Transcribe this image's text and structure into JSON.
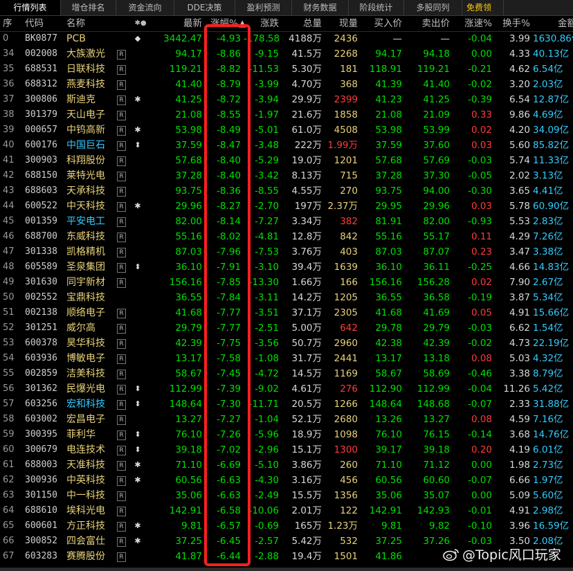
{
  "tabs": [
    "行情列表",
    "增仓排名",
    "资金流向",
    "DDE决策",
    "盈利预测",
    "财务数据",
    "阶段统计",
    "多股同列",
    "免费领"
  ],
  "headers": {
    "idx": "序",
    "code": "代码",
    "name": "名称",
    "mark": "✱●",
    "price": "最新",
    "chg": "涨幅%",
    "chgamt": "涨跌",
    "vol": "总量",
    "cur": "现量",
    "bid": "买入价",
    "ask": "卖出价",
    "spd": "涨速%",
    "turn": "换手%",
    "amt": "金额"
  },
  "sort_glyph": "▲",
  "watermark": "@Topic风口玩家",
  "rows": [
    {
      "idx": "0",
      "code": "BK0877",
      "name": "PCB",
      "r": "",
      "mark": "◆",
      "price": "3442.47",
      "chg": "-4.93",
      "chgamt": "-178.58",
      "vol": "4188万",
      "cur": "2436",
      "bid": "—",
      "ask": "—",
      "spd": "-0.04",
      "turn": "3.99",
      "amt": "1630.86亿"
    },
    {
      "idx": "34",
      "code": "002008",
      "name": "大族激光",
      "r": "R",
      "mark": "",
      "price": "94.17",
      "chg": "-8.86",
      "chgamt": "-9.15",
      "vol": "41.5万",
      "cur": "2268",
      "bid": "94.17",
      "ask": "94.18",
      "spd": "0.00",
      "turn": "4.33",
      "amt": "40.13亿"
    },
    {
      "idx": "35",
      "code": "688531",
      "name": "日联科技",
      "r": "R",
      "mark": "",
      "price": "119.21",
      "chg": "-8.82",
      "chgamt": "-11.53",
      "vol": "5.30万",
      "cur": "181",
      "bid": "118.91",
      "ask": "119.21",
      "spd": "-0.21",
      "turn": "4.62",
      "amt": "6.54亿"
    },
    {
      "idx": "36",
      "code": "688312",
      "name": "燕麦科技",
      "r": "R",
      "mark": "",
      "price": "41.40",
      "chg": "-8.79",
      "chgamt": "-3.99",
      "vol": "4.70万",
      "cur": "368",
      "bid": "41.39",
      "ask": "41.40",
      "spd": "-0.02",
      "turn": "3.20",
      "amt": "2.03亿"
    },
    {
      "idx": "37",
      "code": "300806",
      "name": "斯迪克",
      "r": "R",
      "mark": "✱",
      "price": "41.25",
      "chg": "-8.72",
      "chgamt": "-3.94",
      "vol": "29.9万",
      "cur": "2399",
      "curRed": true,
      "bid": "41.23",
      "ask": "41.25",
      "spd": "-0.39",
      "turn": "6.54",
      "amt": "12.87亿"
    },
    {
      "idx": "38",
      "code": "301379",
      "name": "天山电子",
      "r": "R",
      "mark": "",
      "price": "21.08",
      "chg": "-8.55",
      "chgamt": "-1.97",
      "vol": "21.6万",
      "cur": "1858",
      "bid": "21.08",
      "ask": "21.09",
      "spd": "0.33",
      "spdRed": true,
      "turn": "9.86",
      "amt": "4.69亿"
    },
    {
      "idx": "39",
      "code": "000657",
      "name": "中钨高新",
      "r": "R",
      "mark": "✱",
      "price": "53.98",
      "chg": "-8.49",
      "chgamt": "-5.01",
      "vol": "61.0万",
      "cur": "4508",
      "bid": "53.98",
      "ask": "53.99",
      "spd": "0.02",
      "spdRed": true,
      "turn": "4.20",
      "amt": "34.09亿"
    },
    {
      "idx": "40",
      "code": "600176",
      "name": "中国巨石",
      "cyan": true,
      "r": "R",
      "mark": "⬍",
      "price": "37.59",
      "chg": "-8.47",
      "chgamt": "-3.48",
      "vol": "222万",
      "cur": "1.99万",
      "curRed": true,
      "bid": "37.59",
      "ask": "37.60",
      "spd": "0.03",
      "spdRed": true,
      "turn": "5.60",
      "amt": "85.82亿"
    },
    {
      "idx": "41",
      "code": "300903",
      "name": "科翔股份",
      "r": "R",
      "mark": "",
      "price": "57.68",
      "chg": "-8.40",
      "chgamt": "-5.29",
      "vol": "19.0万",
      "cur": "1201",
      "bid": "57.68",
      "ask": "57.69",
      "spd": "-0.03",
      "turn": "5.74",
      "amt": "11.33亿"
    },
    {
      "idx": "42",
      "code": "688150",
      "name": "莱特光电",
      "r": "R",
      "mark": "",
      "price": "37.28",
      "chg": "-8.40",
      "chgamt": "-3.42",
      "vol": "8.13万",
      "cur": "715",
      "bid": "37.28",
      "ask": "37.30",
      "spd": "-0.05",
      "turn": "2.02",
      "amt": "3.13亿"
    },
    {
      "idx": "43",
      "code": "688603",
      "name": "天承科技",
      "r": "R",
      "mark": "",
      "price": "93.75",
      "chg": "-8.36",
      "chgamt": "-8.55",
      "vol": "4.55万",
      "cur": "270",
      "bid": "93.75",
      "ask": "94.00",
      "spd": "-0.30",
      "turn": "3.65",
      "amt": "4.41亿"
    },
    {
      "idx": "44",
      "code": "600522",
      "name": "中天科技",
      "r": "R",
      "mark": "✱",
      "price": "29.96",
      "chg": "-8.27",
      "chgamt": "-2.70",
      "vol": "197万",
      "cur": "2.37万",
      "bid": "29.95",
      "ask": "29.96",
      "spd": "0.03",
      "spdRed": true,
      "turn": "5.78",
      "amt": "60.90亿"
    },
    {
      "idx": "45",
      "code": "001359",
      "name": "平安电工",
      "cyan": true,
      "r": "R",
      "mark": "",
      "price": "82.00",
      "chg": "-8.14",
      "chgamt": "-7.27",
      "vol": "3.34万",
      "cur": "382",
      "curRed": true,
      "bid": "81.91",
      "ask": "82.00",
      "spd": "-0.93",
      "turn": "5.53",
      "amt": "2.83亿"
    },
    {
      "idx": "46",
      "code": "688700",
      "name": "东威科技",
      "r": "R",
      "mark": "",
      "price": "55.16",
      "chg": "-8.02",
      "chgamt": "-4.81",
      "vol": "12.8万",
      "cur": "842",
      "bid": "55.16",
      "ask": "55.17",
      "spd": "0.11",
      "spdRed": true,
      "turn": "4.29",
      "amt": "7.26亿"
    },
    {
      "idx": "47",
      "code": "301338",
      "name": "凯格精机",
      "r": "R",
      "mark": "",
      "price": "87.03",
      "chg": "-7.96",
      "chgamt": "-7.53",
      "vol": "3.76万",
      "cur": "403",
      "bid": "87.03",
      "ask": "87.07",
      "spd": "0.23",
      "spdRed": true,
      "turn": "3.47",
      "amt": "3.38亿"
    },
    {
      "idx": "48",
      "code": "605589",
      "name": "圣泉集团",
      "r": "R",
      "mark": "⬍",
      "price": "36.10",
      "chg": "-7.91",
      "chgamt": "-3.10",
      "vol": "39.4万",
      "cur": "1639",
      "bid": "36.10",
      "ask": "36.11",
      "spd": "-0.25",
      "turn": "4.66",
      "amt": "14.83亿"
    },
    {
      "idx": "49",
      "code": "301630",
      "name": "同宇新材",
      "r": "R",
      "mark": "",
      "price": "156.16",
      "chg": "-7.85",
      "chgamt": "-13.30",
      "vol": "1.66万",
      "cur": "166",
      "bid": "156.16",
      "ask": "156.28",
      "spd": "0.02",
      "spdRed": true,
      "turn": "7.90",
      "amt": "2.67亿"
    },
    {
      "idx": "50",
      "code": "002552",
      "name": "宝鼎科技",
      "r": "",
      "mark": "",
      "price": "36.55",
      "chg": "-7.84",
      "chgamt": "-3.11",
      "vol": "14.2万",
      "cur": "1205",
      "bid": "36.55",
      "ask": "36.58",
      "spd": "-0.19",
      "turn": "3.87",
      "amt": "5.34亿"
    },
    {
      "idx": "51",
      "code": "002138",
      "name": "顺络电子",
      "r": "R",
      "mark": "",
      "price": "41.68",
      "chg": "-7.77",
      "chgamt": "-3.51",
      "vol": "37.1万",
      "cur": "2305",
      "bid": "41.68",
      "ask": "41.69",
      "spd": "0.05",
      "spdRed": true,
      "turn": "4.91",
      "amt": "15.66亿"
    },
    {
      "idx": "52",
      "code": "301251",
      "name": "威尔高",
      "r": "R",
      "mark": "",
      "price": "29.79",
      "chg": "-7.77",
      "chgamt": "-2.51",
      "vol": "5.00万",
      "cur": "642",
      "curRed": true,
      "bid": "29.78",
      "ask": "29.79",
      "spd": "-0.03",
      "turn": "6.62",
      "amt": "1.54亿"
    },
    {
      "idx": "53",
      "code": "600378",
      "name": "昊华科技",
      "r": "R",
      "mark": "",
      "price": "42.39",
      "chg": "-7.75",
      "chgamt": "-3.56",
      "vol": "50.7万",
      "cur": "2960",
      "bid": "42.38",
      "ask": "42.39",
      "spd": "-0.02",
      "turn": "4.73",
      "amt": "22.19亿"
    },
    {
      "idx": "54",
      "code": "603936",
      "name": "博敏电子",
      "r": "R",
      "mark": "",
      "price": "13.17",
      "chg": "-7.58",
      "chgamt": "-1.08",
      "vol": "31.7万",
      "cur": "2441",
      "bid": "13.17",
      "ask": "13.18",
      "spd": "0.08",
      "spdRed": true,
      "turn": "5.03",
      "amt": "4.32亿"
    },
    {
      "idx": "55",
      "code": "002859",
      "name": "洁美科技",
      "r": "R",
      "mark": "",
      "price": "58.67",
      "chg": "-7.45",
      "chgamt": "-4.72",
      "vol": "14.5万",
      "cur": "1169",
      "bid": "58.67",
      "ask": "58.69",
      "spd": "-0.46",
      "turn": "3.38",
      "amt": "8.79亿"
    },
    {
      "idx": "56",
      "code": "301362",
      "name": "民爆光电",
      "r": "R",
      "mark": "⬍",
      "price": "112.99",
      "chg": "-7.39",
      "chgamt": "-9.02",
      "vol": "4.61万",
      "cur": "276",
      "curRed": true,
      "bid": "112.90",
      "ask": "112.99",
      "spd": "-0.04",
      "turn": "11.26",
      "amt": "5.42亿"
    },
    {
      "idx": "57",
      "code": "603256",
      "name": "宏和科技",
      "cyan": true,
      "r": "R",
      "mark": "⬍",
      "price": "148.64",
      "chg": "-7.30",
      "chgamt": "-11.71",
      "vol": "20.5万",
      "cur": "1266",
      "bid": "148.64",
      "ask": "148.68",
      "spd": "-0.07",
      "turn": "2.33",
      "amt": "31.88亿"
    },
    {
      "idx": "58",
      "code": "603002",
      "name": "宏昌电子",
      "r": "R",
      "mark": "",
      "price": "13.27",
      "chg": "-7.27",
      "chgamt": "-1.04",
      "vol": "52.1万",
      "cur": "2680",
      "bid": "13.26",
      "ask": "13.27",
      "spd": "0.08",
      "spdRed": true,
      "turn": "4.59",
      "amt": "7.16亿"
    },
    {
      "idx": "59",
      "code": "300395",
      "name": "菲利华",
      "r": "R",
      "mark": "⬍",
      "price": "76.10",
      "chg": "-7.26",
      "chgamt": "-5.96",
      "vol": "18.9万",
      "cur": "1098",
      "bid": "76.10",
      "ask": "76.15",
      "spd": "-0.14",
      "turn": "3.68",
      "amt": "14.76亿"
    },
    {
      "idx": "60",
      "code": "300679",
      "name": "电连技术",
      "r": "R",
      "mark": "⬍",
      "price": "39.18",
      "chg": "-7.02",
      "chgamt": "-2.96",
      "vol": "15.1万",
      "cur": "1300",
      "curRed": true,
      "bid": "39.17",
      "ask": "39.18",
      "spd": "0.20",
      "spdRed": true,
      "turn": "4.19",
      "amt": "6.01亿"
    },
    {
      "idx": "61",
      "code": "688003",
      "name": "天准科技",
      "r": "R",
      "mark": "✱",
      "price": "71.10",
      "chg": "-6.69",
      "chgamt": "-5.10",
      "vol": "3.86万",
      "cur": "260",
      "bid": "71.10",
      "ask": "71.12",
      "spd": "0.00",
      "turn": "1.98",
      "amt": "2.73亿"
    },
    {
      "idx": "62",
      "code": "300936",
      "name": "中英科技",
      "r": "R",
      "mark": "✱",
      "price": "60.56",
      "chg": "-6.63",
      "chgamt": "-4.30",
      "vol": "3.16万",
      "cur": "456",
      "bid": "60.56",
      "ask": "60.60",
      "spd": "-0.07",
      "turn": "6.66",
      "amt": "1.97亿"
    },
    {
      "idx": "63",
      "code": "301150",
      "name": "中一科技",
      "r": "R",
      "mark": "",
      "price": "35.06",
      "chg": "-6.63",
      "chgamt": "-2.49",
      "vol": "15.5万",
      "cur": "1356",
      "bid": "35.06",
      "ask": "35.07",
      "spd": "0.00",
      "turn": "5.09",
      "amt": "5.60亿"
    },
    {
      "idx": "64",
      "code": "688610",
      "name": "埃科光电",
      "r": "R",
      "mark": "",
      "price": "142.91",
      "chg": "-6.58",
      "chgamt": "-10.06",
      "vol": "2.01万",
      "cur": "122",
      "bid": "142.91",
      "ask": "142.93",
      "spd": "-0.01",
      "turn": "4.91",
      "amt": "2.98亿"
    },
    {
      "idx": "65",
      "code": "600601",
      "name": "方正科技",
      "r": "R",
      "mark": "✱",
      "price": "9.81",
      "chg": "-6.57",
      "chgamt": "-0.69",
      "vol": "165万",
      "cur": "1.23万",
      "bid": "9.81",
      "ask": "9.82",
      "spd": "-0.10",
      "turn": "3.96",
      "amt": "16.59亿"
    },
    {
      "idx": "66",
      "code": "300852",
      "name": "四会富仕",
      "r": "R",
      "mark": "✱",
      "price": "37.25",
      "chg": "-6.45",
      "chgamt": "-2.57",
      "vol": "5.42万",
      "cur": "532",
      "bid": "37.25",
      "ask": "37.26",
      "spd": "-0.03",
      "turn": "3.50",
      "amt": "2.08亿"
    },
    {
      "idx": "67",
      "code": "603283",
      "name": "赛腾股份",
      "r": "R",
      "mark": "",
      "price": "41.87",
      "chg": "-6.44",
      "chgamt": "-2.88",
      "vol": "19.4万",
      "cur": "1501",
      "bid": "41.86",
      "ask": "",
      "spd": "",
      "turn": "",
      "amt": ""
    }
  ]
}
